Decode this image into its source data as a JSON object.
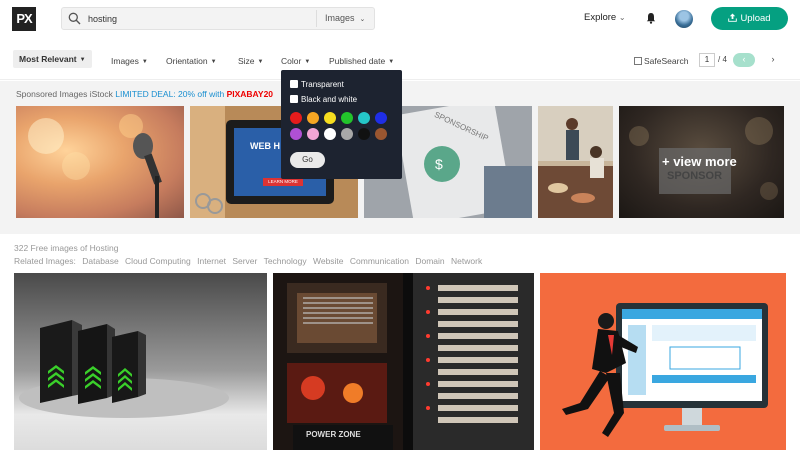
{
  "header": {
    "logo": "PX",
    "search_value": "hosting",
    "search_type": "Images",
    "explore": "Explore",
    "upload": "Upload"
  },
  "filters": {
    "relevance": "Most Relevant",
    "images": "Images",
    "orientation": "Orientation",
    "size": "Size",
    "color": "Color",
    "published": "Published date",
    "safesearch": "SafeSearch",
    "page_current": "1",
    "page_total": "/ 4"
  },
  "color_dropdown": {
    "transparent": "Transparent",
    "black_white": "Black and white",
    "swatches": [
      "#e51c1c",
      "#f6a623",
      "#f6dd1f",
      "#22c42b",
      "#25c6c8",
      "#1f2ee6",
      "#b050d4",
      "#f3a6d6",
      "#ffffff",
      "#a8a8a8",
      "#111111",
      "#9a5630"
    ],
    "go": "Go"
  },
  "sponsored": {
    "prefix": "Sponsored Images iStock",
    "deal": "LIMITED DEAL: 20% off with",
    "code": "PIXABAY20",
    "view_more": "+ view more",
    "view_more_sub": "SPONSOR",
    "card2_text": "WEB H",
    "card2_button": "LEARN MORE",
    "card3_text": "SPONSORSHIP"
  },
  "results": {
    "count": "322 Free images of Hosting",
    "related_label": "Related Images:",
    "related": [
      "Database",
      "Cloud Computing",
      "Internet",
      "Server",
      "Technology",
      "Website",
      "Communication",
      "Domain",
      "Network"
    ],
    "image2_caption": "POWER ZONE"
  },
  "colors": {
    "accent": "#05a081",
    "dropdown_bg": "#1d2330"
  }
}
